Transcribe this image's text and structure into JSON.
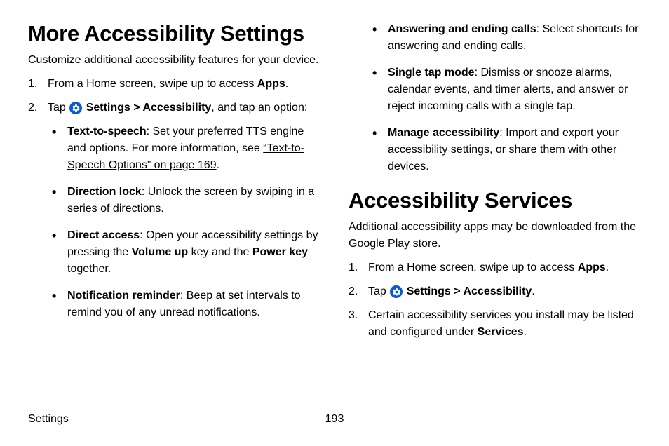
{
  "left": {
    "heading": "More Accessibility Settings",
    "intro": "Customize additional accessibility features for your device.",
    "step1_pre": "From a Home screen, swipe up to access ",
    "step1_bold": "Apps",
    "step1_post": ".",
    "step2_pre": "Tap ",
    "step2_settings": "Settings",
    "step2_sep": " > ",
    "step2_access": "Accessibility",
    "step2_post": ", and tap an option:",
    "bullets": {
      "tts_b": "Text-to-speech",
      "tts_t1": ": Set your preferred TTS engine and options. For more information, see ",
      "tts_link": "“Text-to-Speech Options” on page 169",
      "tts_t2": ".",
      "dirlock_b": "Direction lock",
      "dirlock_t": ": Unlock the screen by swiping in a series of directions.",
      "diracc_b": "Direct access",
      "diracc_t1": ": Open your accessibility settings by pressing the ",
      "diracc_b2": "Volume up",
      "diracc_t2": " key and the ",
      "diracc_b3": "Power key",
      "diracc_t3": " together.",
      "notif_b": "Notification reminder",
      "notif_t": ": Beep at set intervals to remind you of any unread notifications."
    }
  },
  "right": {
    "bullets": {
      "ans_b": "Answering and ending calls",
      "ans_t": ": Select shortcuts for answering and ending calls.",
      "single_b": "Single tap mode",
      "single_t": ": Dismiss or snooze alarms, calendar events, and timer alerts, and answer or reject incoming calls with a single tap.",
      "manage_b": "Manage accessibility",
      "manage_t": ": Import and export your accessibility settings, or share them with other devices."
    },
    "heading2": "Accessibility Services",
    "intro2": "Additional accessibility apps may be downloaded from the Google Play store.",
    "s1_pre": "From a Home screen, swipe up to access ",
    "s1_bold": "Apps",
    "s1_post": ".",
    "s2_pre": "Tap ",
    "s2_settings": "Settings",
    "s2_sep": " > ",
    "s2_access": "Accessibility",
    "s2_post": ".",
    "s3_pre": "Certain accessibility services you install may be listed and configured under ",
    "s3_bold": "Services",
    "s3_post": "."
  },
  "footer": {
    "section": "Settings",
    "page": "193"
  }
}
